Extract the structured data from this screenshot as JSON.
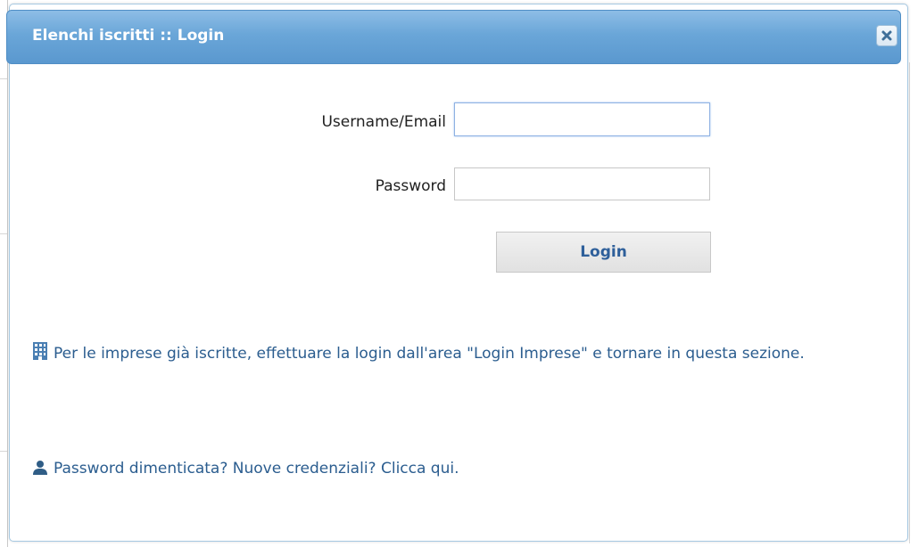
{
  "dialog": {
    "title": "Elenchi iscritti :: Login",
    "close_icon": "close-icon",
    "colors": {
      "titlebar_top": "#8dbde6",
      "titlebar_bottom": "#5a98cf",
      "link_text": "#2b5d8f",
      "button_text": "#2e5f9a"
    }
  },
  "form": {
    "username_label": "Username/Email",
    "username_value": "",
    "password_label": "Password",
    "password_value": "",
    "login_button": "Login"
  },
  "info": {
    "icon": "building-icon",
    "text": "Per le imprese già iscritte, effettuare la login dall'area \"Login Imprese\" e tornare in questa sezione."
  },
  "recovery": {
    "icon": "user-icon",
    "text": "Password dimenticata? Nuove credenziali? Clicca qui."
  }
}
